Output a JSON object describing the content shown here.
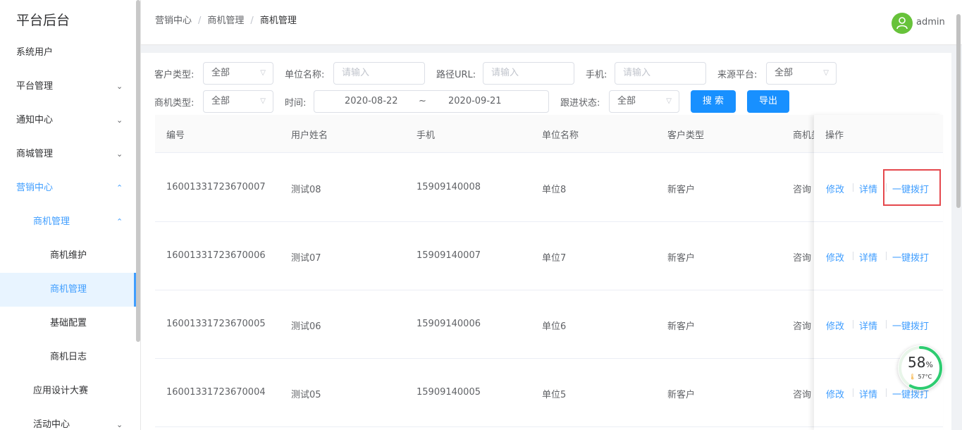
{
  "sidebar": {
    "logo": "平台后台",
    "items": [
      {
        "label": "系统用户",
        "chevron": ""
      },
      {
        "label": "平台管理",
        "chevron": "⌄"
      },
      {
        "label": "通知中心",
        "chevron": "⌄"
      },
      {
        "label": "商城管理",
        "chevron": "⌄"
      },
      {
        "label": "营销中心",
        "chevron": "⌃"
      },
      {
        "label": "商机管理",
        "chevron": "⌃"
      },
      {
        "label": "商机维护",
        "chevron": ""
      },
      {
        "label": "商机管理",
        "chevron": ""
      },
      {
        "label": "基础配置",
        "chevron": ""
      },
      {
        "label": "商机日志",
        "chevron": ""
      },
      {
        "label": "应用设计大赛",
        "chevron": ""
      },
      {
        "label": "活动中心",
        "chevron": "⌄"
      }
    ]
  },
  "header": {
    "breadcrumb": [
      "营销中心",
      "商机管理",
      "商机管理"
    ],
    "separator": "/",
    "username": "admin"
  },
  "filters": {
    "customer_type_label": "客户类型:",
    "customer_type_value": "全部",
    "company_label": "单位名称:",
    "company_placeholder": "请输入",
    "path_label": "路径URL:",
    "path_placeholder": "请输入",
    "phone_label": "手机:",
    "phone_placeholder": "请输入",
    "source_label": "来源平台:",
    "source_value": "全部",
    "biz_type_label": "商机类型:",
    "biz_type_value": "全部",
    "time_label": "时间:",
    "date_start": "2020-08-22",
    "date_sep": "~",
    "date_end": "2020-09-21",
    "follow_label": "跟进状态:",
    "follow_value": "全部",
    "search_button": "搜 索",
    "export_button": "导出"
  },
  "table": {
    "columns": [
      "编号",
      "用户姓名",
      "手机",
      "单位名称",
      "客户类型",
      "商机类",
      "操作"
    ],
    "rows": [
      {
        "id": "16001331723670007",
        "name": "测试08",
        "phone": "15909140008",
        "company": "单位8",
        "ctype": "新客户",
        "btype": "咨询"
      },
      {
        "id": "16001331723670006",
        "name": "测试07",
        "phone": "15909140007",
        "company": "单位7",
        "ctype": "新客户",
        "btype": "咨询"
      },
      {
        "id": "16001331723670005",
        "name": "测试06",
        "phone": "15909140006",
        "company": "单位6",
        "ctype": "新客户",
        "btype": "咨询"
      },
      {
        "id": "16001331723670004",
        "name": "测试05",
        "phone": "15909140005",
        "company": "单位5",
        "ctype": "新客户",
        "btype": "咨询"
      }
    ],
    "actions": {
      "edit": "修改",
      "detail": "详情",
      "call": "一键拨打"
    }
  },
  "overlay": {
    "percent": "58",
    "percent_unit": "%",
    "temperature": "57°C",
    "progress": 0.58,
    "accent": "#2ecc71"
  }
}
